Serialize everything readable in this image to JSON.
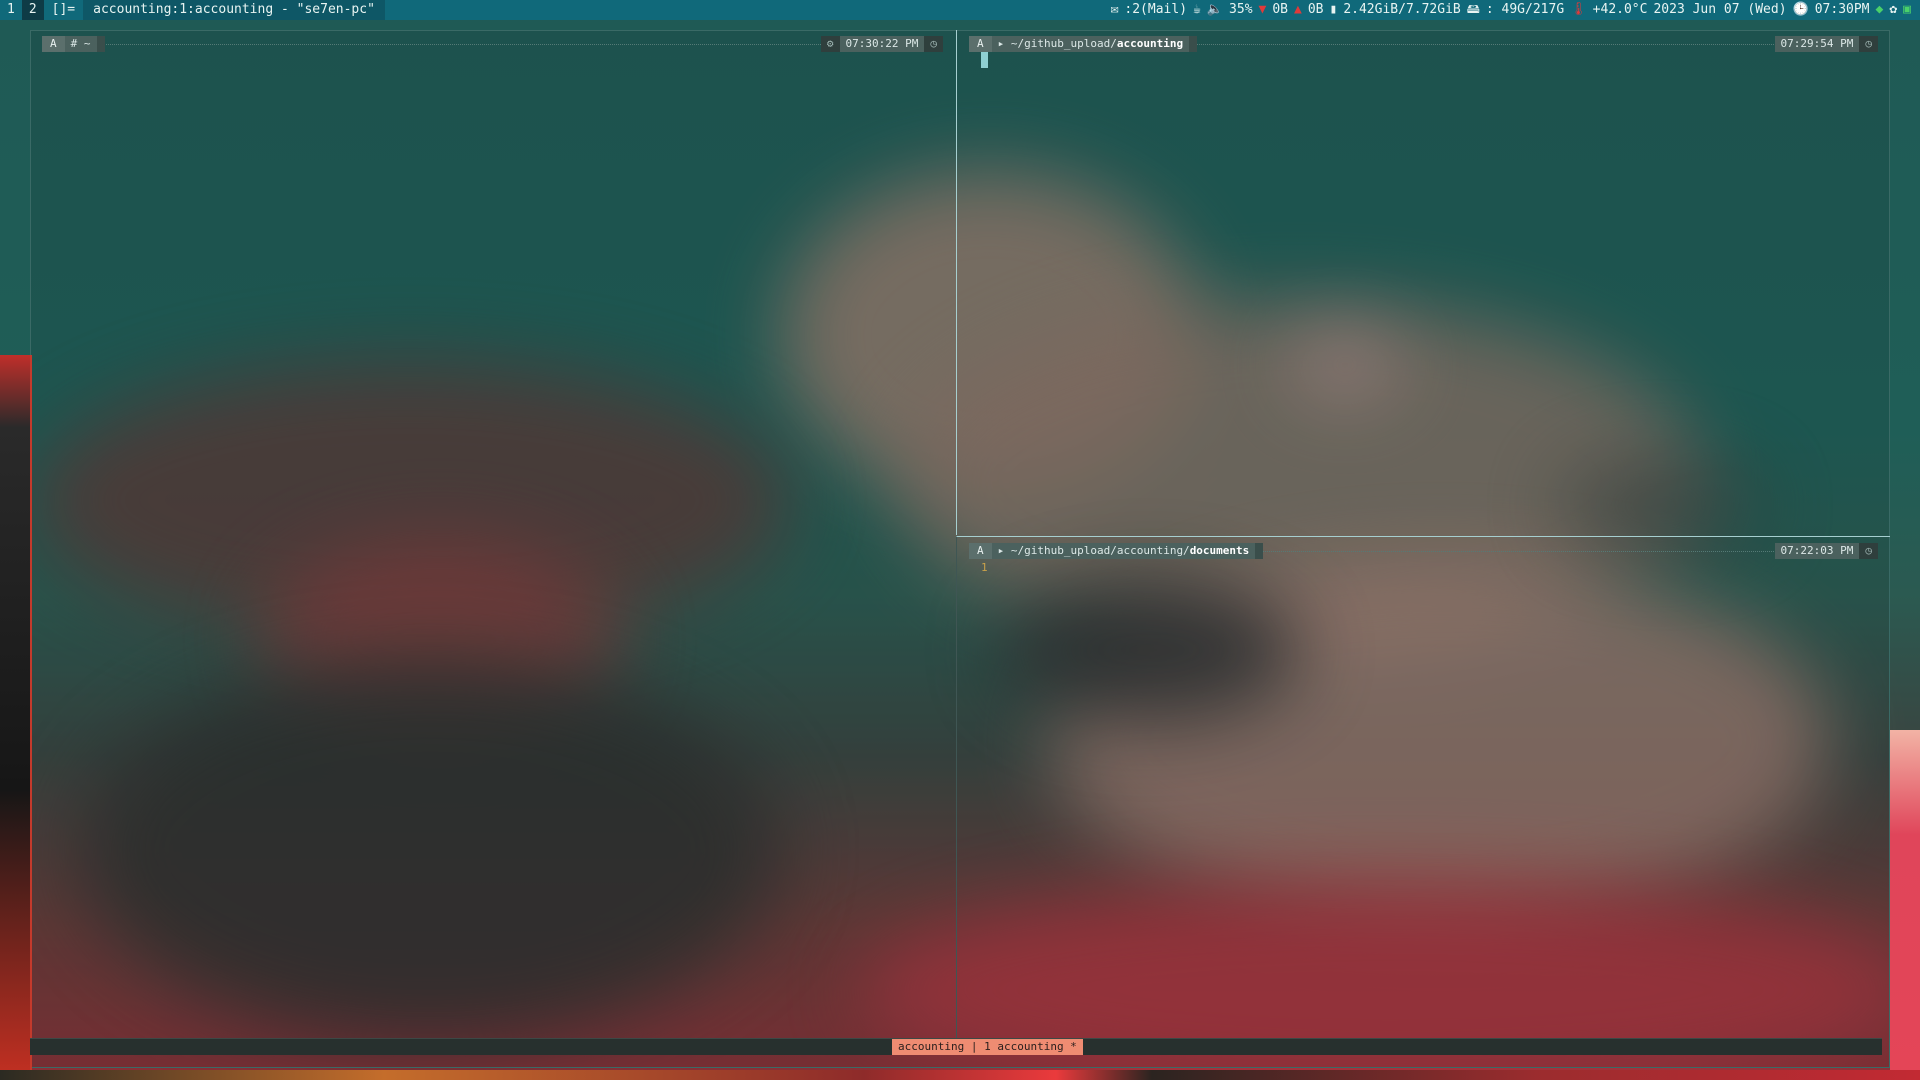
{
  "topbar": {
    "tags": [
      "1",
      "2"
    ],
    "layout": "[]=",
    "window_title": "accounting:1:accounting - \"se7en-pc\"",
    "status": {
      "mail": ":2(Mail)",
      "volume": "35%",
      "net_down": "0B",
      "net_up": "0B",
      "memory": "2.42GiB/7.72GiB",
      "disk": ": 49G/217G",
      "temp": "+42.0°C",
      "date": "2023 Jun 07 (Wed)",
      "clock": "07:30PM"
    }
  },
  "panes": {
    "left": {
      "os": "A",
      "dir": "# ~",
      "time": "07:30:22 PM"
    },
    "top_right": {
      "os": "A",
      "dir_prefix": "~/github_upload/",
      "dir_bold": "accounting",
      "time": "07:29:54 PM"
    },
    "bottom_right": {
      "os": "A",
      "dir_prefix": "~/github_upload/accounting/",
      "dir_bold": "documents",
      "time": "07:22:03 PM",
      "line_number": "1"
    }
  },
  "tmux": {
    "tab": "accounting | 1 accounting *"
  },
  "colors": {
    "topbar": "#10697a",
    "accent_tab": "#ef8c72",
    "divider": "#a6cfd0"
  }
}
